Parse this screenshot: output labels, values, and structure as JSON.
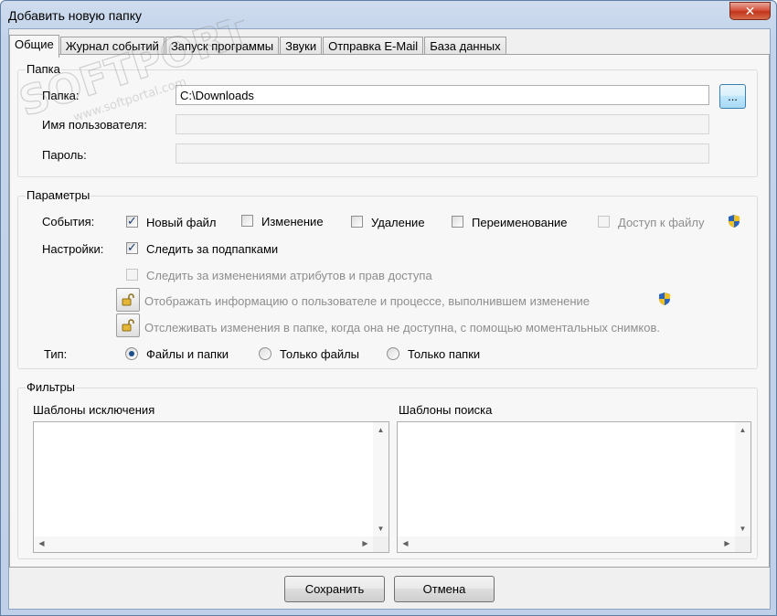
{
  "window": {
    "title": "Добавить новую папку",
    "close_glyph": "✕"
  },
  "tabs": [
    {
      "label": "Общие",
      "active": true
    },
    {
      "label": "Журнал событий"
    },
    {
      "label": "Запуск программы"
    },
    {
      "label": "Звуки"
    },
    {
      "label": "Отправка E-Mail"
    },
    {
      "label": "База данных"
    }
  ],
  "folder_group": {
    "title": "Папка",
    "folder_label": "Папка:",
    "folder_value": "C:\\Downloads",
    "browse_label": "...",
    "user_label": "Имя пользователя:",
    "user_value": "",
    "password_label": "Пароль:",
    "password_value": ""
  },
  "params_group": {
    "title": "Параметры",
    "events_label": "События:",
    "events": [
      {
        "label": "Новый файл",
        "checked": true
      },
      {
        "label": "Изменение",
        "checked": false
      },
      {
        "label": "Удаление",
        "checked": false
      },
      {
        "label": "Переименование",
        "checked": false
      },
      {
        "label": "Доступ к файлу",
        "checked": false,
        "disabled": true
      }
    ],
    "settings_label": "Настройки:",
    "watch_subfolders": "Следить за подпапками",
    "watch_attrs": "Следить за изменениями атрибутов и прав доступа",
    "show_user_info": "Отображать информацию о пользователе и процессе, выполнившем изменение",
    "track_snapshots": "Отслеживать изменения в папке, когда она не доступна, с помощью моментальных снимков.",
    "type_label": "Тип:",
    "types": [
      {
        "label": "Файлы и папки",
        "selected": true
      },
      {
        "label": "Только файлы",
        "selected": false
      },
      {
        "label": "Только папки",
        "selected": false
      }
    ]
  },
  "filters_group": {
    "title": "Фильтры",
    "exclude_label": "Шаблоны исключения",
    "search_label": "Шаблоны поиска"
  },
  "footer": {
    "save_label": "Сохранить",
    "cancel_label": "Отмена"
  },
  "watermark": {
    "brand": "SOFTPORTAL",
    "url": "www.softportal.com"
  },
  "colors": {
    "title_bar": "#c3d4ea",
    "close_button": "#c2351a",
    "panel_bg": "#f7f7f7",
    "check_mark": "#1e3a6f"
  }
}
